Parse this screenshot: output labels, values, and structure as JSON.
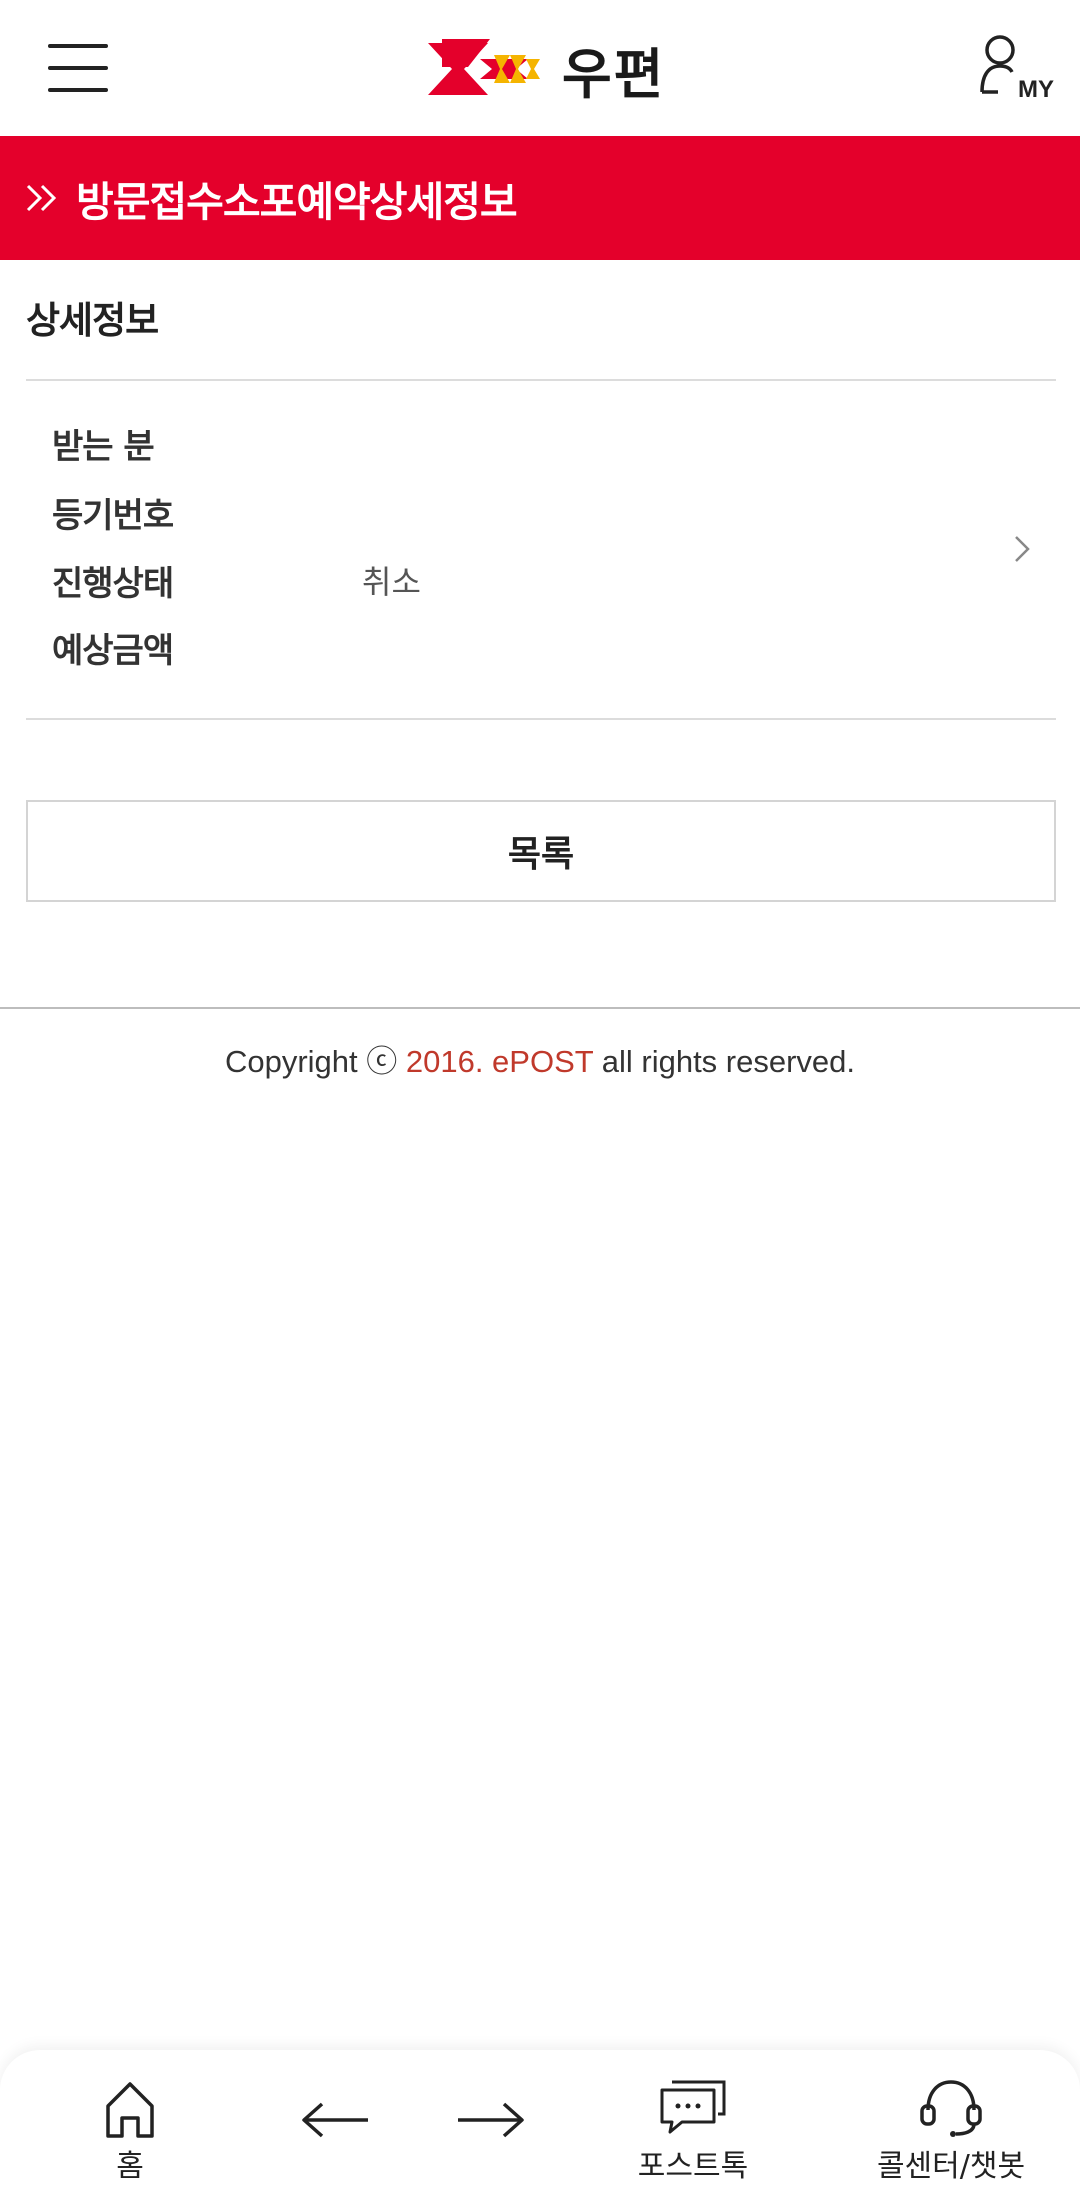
{
  "header": {
    "logo_text": "우편",
    "my_label": "MY"
  },
  "colors": {
    "brand_red": "#e4002b",
    "accent_text": "#c0392b",
    "logo_yellow": "#f5b400"
  },
  "page": {
    "title": "방문접수소포예약상세정보"
  },
  "detail": {
    "section_title": "상세정보",
    "rows": [
      {
        "label": "받는 분",
        "value": ""
      },
      {
        "label": "등기번호",
        "value": ""
      },
      {
        "label": "진행상태",
        "value": "취소"
      },
      {
        "label": "예상금액",
        "value": ""
      }
    ]
  },
  "actions": {
    "list_button": "목록"
  },
  "footer": {
    "copyright_prefix": "Copyright ⓒ ",
    "copyright_accent": "2016. ePOST",
    "copyright_suffix": " all rights reserved."
  },
  "bottom_nav": {
    "home": "홈",
    "back_icon": "arrow-left-icon",
    "forward_icon": "arrow-right-icon",
    "posttalk": "포스트톡",
    "callcenter": "콜센터/챗봇"
  }
}
